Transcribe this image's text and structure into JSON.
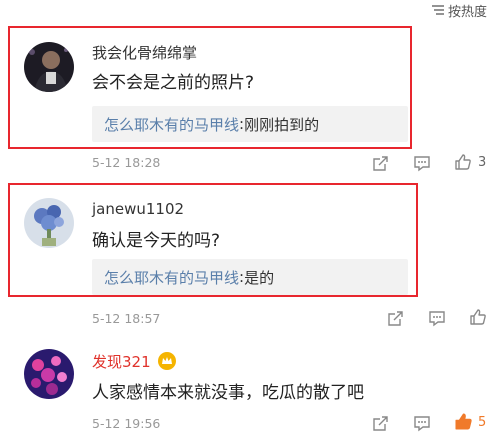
{
  "sort": {
    "label": "按热度",
    "icon": "sort-lines-icon"
  },
  "comments": [
    {
      "username": "我会化骨绵绵掌",
      "text": "会不会是之前的照片?",
      "reply": {
        "author": "怎么耶木有的马甲线",
        "colon": ":",
        "text": " 刚刚拍到的"
      },
      "time": "5-12 18:28",
      "likes": "3",
      "liked": false
    },
    {
      "username": "janewu1102",
      "text": "确认是今天的吗?",
      "reply": {
        "author": "怎么耶木有的马甲线",
        "colon": ":",
        "text": " 是的"
      },
      "time": "5-12 18:57",
      "likes": "",
      "liked": false
    },
    {
      "username": "发现321",
      "text": "人家感情本来就没事，吃瓜的散了吧",
      "time": "5-12 19:56",
      "likes": "5",
      "liked": true
    }
  ],
  "colors": {
    "highlight_frame": "#e8262e",
    "link": "#5a7faa",
    "username_highlight": "#e0322b",
    "like_active": "#f07a2a"
  }
}
